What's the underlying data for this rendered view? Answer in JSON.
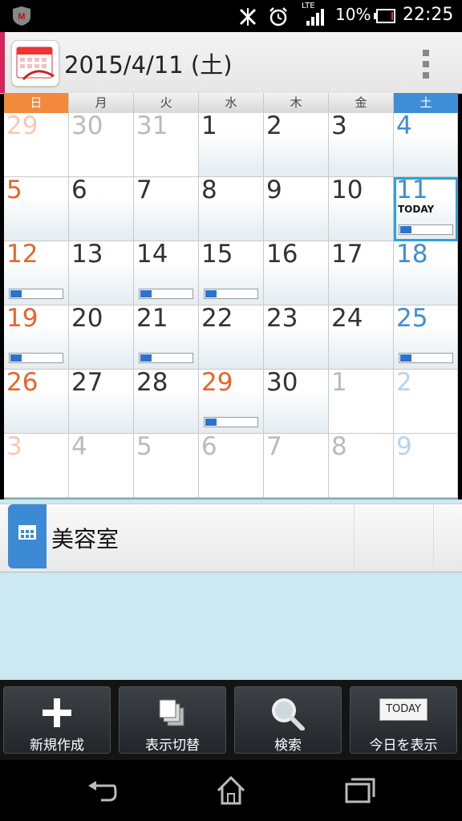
{
  "status_bar": {
    "battery_percent": "10%",
    "time": "22:25",
    "network": "LTE",
    "icons": [
      "mcafee-icon",
      "nfc-icon",
      "alarm-icon",
      "signal-icon",
      "battery-icon"
    ]
  },
  "app_bar": {
    "title": "2015/4/11 (土)",
    "app_icon": "scheduler-calendar-icon",
    "menu_icon": "overflow-menu-icon",
    "accent_color": "#d6245a"
  },
  "calendar": {
    "weekdays": [
      "日",
      "月",
      "火",
      "水",
      "木",
      "金",
      "土"
    ],
    "today_label": "TODAY",
    "today_color": "#2ba3dc",
    "sunday_color": "#e8652a",
    "saturday_color": "#3e8ed6",
    "weeks": [
      [
        {
          "day": "29",
          "other": true
        },
        {
          "day": "30",
          "other": true
        },
        {
          "day": "31",
          "other": true
        },
        {
          "day": "1",
          "other": false
        },
        {
          "day": "2",
          "other": false
        },
        {
          "day": "3",
          "other": false
        },
        {
          "day": "4",
          "other": false
        }
      ],
      [
        {
          "day": "5",
          "other": false
        },
        {
          "day": "6",
          "other": false
        },
        {
          "day": "7",
          "other": false
        },
        {
          "day": "8",
          "other": false
        },
        {
          "day": "9",
          "other": false
        },
        {
          "day": "10",
          "other": false
        },
        {
          "day": "11",
          "other": false,
          "today": true,
          "event": true
        }
      ],
      [
        {
          "day": "12",
          "other": false,
          "event": true
        },
        {
          "day": "13",
          "other": false
        },
        {
          "day": "14",
          "other": false,
          "event": true
        },
        {
          "day": "15",
          "other": false,
          "event": true
        },
        {
          "day": "16",
          "other": false
        },
        {
          "day": "17",
          "other": false
        },
        {
          "day": "18",
          "other": false
        }
      ],
      [
        {
          "day": "19",
          "other": false,
          "event": true
        },
        {
          "day": "20",
          "other": false
        },
        {
          "day": "21",
          "other": false,
          "event": true
        },
        {
          "day": "22",
          "other": false
        },
        {
          "day": "23",
          "other": false
        },
        {
          "day": "24",
          "other": false
        },
        {
          "day": "25",
          "other": false,
          "event": true
        }
      ],
      [
        {
          "day": "26",
          "other": false
        },
        {
          "day": "27",
          "other": false
        },
        {
          "day": "28",
          "other": false
        },
        {
          "day": "29",
          "other": false,
          "event": true,
          "holiday": true
        },
        {
          "day": "30",
          "other": false
        },
        {
          "day": "1",
          "other": true
        },
        {
          "day": "2",
          "other": true
        }
      ],
      [
        {
          "day": "3",
          "other": true
        },
        {
          "day": "4",
          "other": true
        },
        {
          "day": "5",
          "other": true
        },
        {
          "day": "6",
          "other": true
        },
        {
          "day": "7",
          "other": true
        },
        {
          "day": "8",
          "other": true
        },
        {
          "day": "9",
          "other": true
        }
      ]
    ]
  },
  "event_list": {
    "item_title": "美容室",
    "item_icon": "calendar-grid-icon",
    "tag_color": "#3c8ad4"
  },
  "toolbar": {
    "buttons": [
      {
        "label": "新規作成",
        "icon": "plus-icon"
      },
      {
        "label": "表示切替",
        "icon": "stacked-pages-icon"
      },
      {
        "label": "検索",
        "icon": "search-icon"
      },
      {
        "label": "今日を表示",
        "icon": "today-icon",
        "icon_text": "TODAY"
      }
    ]
  },
  "nav_bar": {
    "icons": [
      "back-icon",
      "home-icon",
      "recent-apps-icon"
    ]
  }
}
